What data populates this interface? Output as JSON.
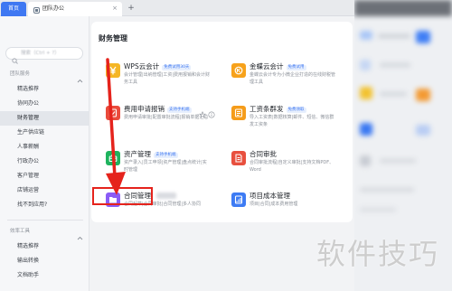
{
  "tabs": {
    "home": "首页",
    "team_office": "团队办公",
    "close": "×",
    "new_tab": "+"
  },
  "sidebar": {
    "search_placeholder": "搜索（Ctrl + ?）",
    "team_section": {
      "title": "团队服务",
      "items": [
        "精选推荐",
        "协同办公",
        "财务管理",
        "生产供应链",
        "人事薪酬",
        "行政办公",
        "客户管理",
        "店铺运营",
        "找不到应用?"
      ],
      "selected": "财务管理"
    },
    "tools_section": {
      "title": "效率工具",
      "items": [
        "精选推荐",
        "输出转换",
        "文档助手"
      ]
    }
  },
  "main": {
    "title": "财务管理",
    "apps": [
      {
        "name": "WPS云会计",
        "badge": "免费试用30天",
        "desc": "会计管理|出纳管理|工资|费用报销和会计财务工具",
        "icon": "accounting-icon",
        "color": "#f5b625"
      },
      {
        "name": "金蝶云会计",
        "badge": "免费试用",
        "desc": "金蝶云会计专为小微企业打造的在线财税管理工具",
        "icon": "kingdee-icon",
        "color": "#f7a21b"
      },
      {
        "name": "费用申请报销",
        "badge": "支持手机端",
        "desc": "费用申请审批|配置审批流程|报销单据汇总",
        "icon": "expense-icon",
        "color": "#ea4b3c"
      },
      {
        "name": "工资条群发",
        "badge": "免费领取",
        "desc": "导入工资表|数据核算|邮件、短信、微信群发工资条",
        "icon": "payslip-icon",
        "color": "#f59c1a"
      },
      {
        "name": "资产管理",
        "badge": "支持手机端",
        "desc": "资产录入|员工申领|资产管理|盘点统计|实时管理",
        "icon": "asset-icon",
        "color": "#1fb35e"
      },
      {
        "name": "合同审批",
        "badge": "",
        "desc": "合同审批流程|自定义审批|支持文档PDF、Word",
        "icon": "contract-approval-icon",
        "color": "#e8503e"
      },
      {
        "name": "合同管理",
        "badge": "",
        "desc": "合同起草|合同审批|合同管理|多人协同",
        "icon": "contract-folder-icon",
        "color": "#8b5cf6"
      },
      {
        "name": "项目成本管理",
        "badge": "",
        "desc": "项目|合同|成本费用管理",
        "icon": "project-cost-icon",
        "color": "#3d7bf4"
      }
    ]
  },
  "watermark": {
    "text": "软件技巧"
  },
  "colors": {
    "brand_blue": "#3f78f2",
    "annotation_red": "#e5231c",
    "selected_bg": "#e3e6eb"
  }
}
